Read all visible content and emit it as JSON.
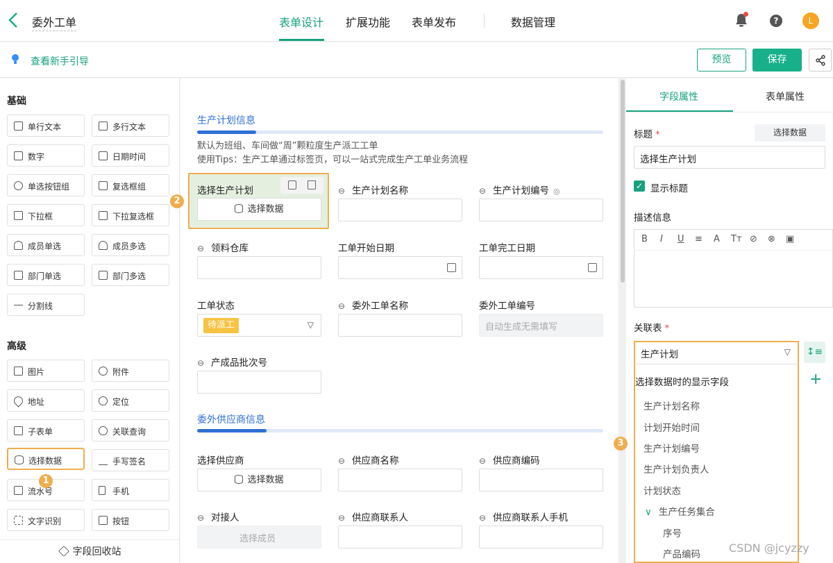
{
  "header": {
    "back_icon": "back-arrow-icon",
    "title": "委外工单",
    "tabs": [
      {
        "label": "表单设计",
        "active": true
      },
      {
        "label": "扩展功能",
        "active": false
      },
      {
        "label": "表单发布",
        "active": false
      },
      {
        "label": "数据管理",
        "active": false
      }
    ],
    "avatar_initial": "L",
    "help_glyph": "?",
    "accent_color": "#17a27e"
  },
  "subbar": {
    "guide_link": "查看新手引导",
    "preview_label": "预览",
    "save_label": "保存"
  },
  "palette": {
    "basic_title": "基础",
    "basic_items": [
      "单行文本",
      "多行文本",
      "数字",
      "日期时间",
      "单选按钮组",
      "复选框组",
      "下拉框",
      "下拉复选框",
      "成员单选",
      "成员多选",
      "部门单选",
      "部门多选",
      "分割线"
    ],
    "advanced_title": "高级",
    "advanced_items": [
      "图片",
      "附件",
      "地址",
      "定位",
      "子表单",
      "关联查询",
      "选择数据",
      "手写签名",
      "流水号",
      "手机",
      "文字识别",
      "按钮"
    ],
    "recycle_label": "字段回收站",
    "badge_1": "1"
  },
  "canvas": {
    "group1": {
      "title": "生产计划信息",
      "desc1": "默认为班组、车间做“周”颗粒度生产派工工单",
      "desc2": "使用Tips：生产工单通过标签页，可以一站式完成生产工单业务流程"
    },
    "badge_2": "2",
    "fields": {
      "select_plan": "选择生产计划",
      "select_plan_btn": "选择数据",
      "plan_name": "生产计划名称",
      "plan_code": "生产计划编号",
      "warehouse": "领料仓库",
      "start_date": "工单开始日期",
      "end_date": "工单完工日期",
      "status": "工单状态",
      "status_value": "待派工",
      "order_name": "委外工单名称",
      "order_code": "委外工单编号",
      "order_code_ph": "自动生成无需填写",
      "batch": "产成品批次号"
    },
    "group2": {
      "title": "委外供应商信息"
    },
    "fields2": {
      "select_supplier": "选择供应商",
      "select_supplier_btn": "选择数据",
      "supplier_name": "供应商名称",
      "supplier_code": "供应商编码",
      "contact": "对接人",
      "contact_ph": "选择成员",
      "supplier_contact": "供应商联系人",
      "supplier_phone": "供应商联系人手机"
    }
  },
  "props": {
    "tab_field": "字段属性",
    "tab_form": "表单属性",
    "title_label": "标题",
    "required_mark": "*",
    "select_data_btn": "选择数据",
    "title_value": "选择生产计划",
    "show_title": "显示标题",
    "check_glyph": "✓",
    "desc_label": "描述信息",
    "rte_tools": [
      "B",
      "I",
      "U",
      "≡",
      "A",
      "Tт"
    ],
    "relation_label": "关联表",
    "relation_value": "生产计划",
    "display_fields_title": "选择数据时的显示字段",
    "display_fields": [
      "生产计划名称",
      "计划开始时间",
      "生产计划编号",
      "生产计划负责人",
      "计划状态"
    ],
    "subtable": "生产任务集合",
    "subtable_fields": [
      "序号",
      "产品编码"
    ],
    "badge_3": "3"
  },
  "watermark": "CSDN @jcyzzy"
}
